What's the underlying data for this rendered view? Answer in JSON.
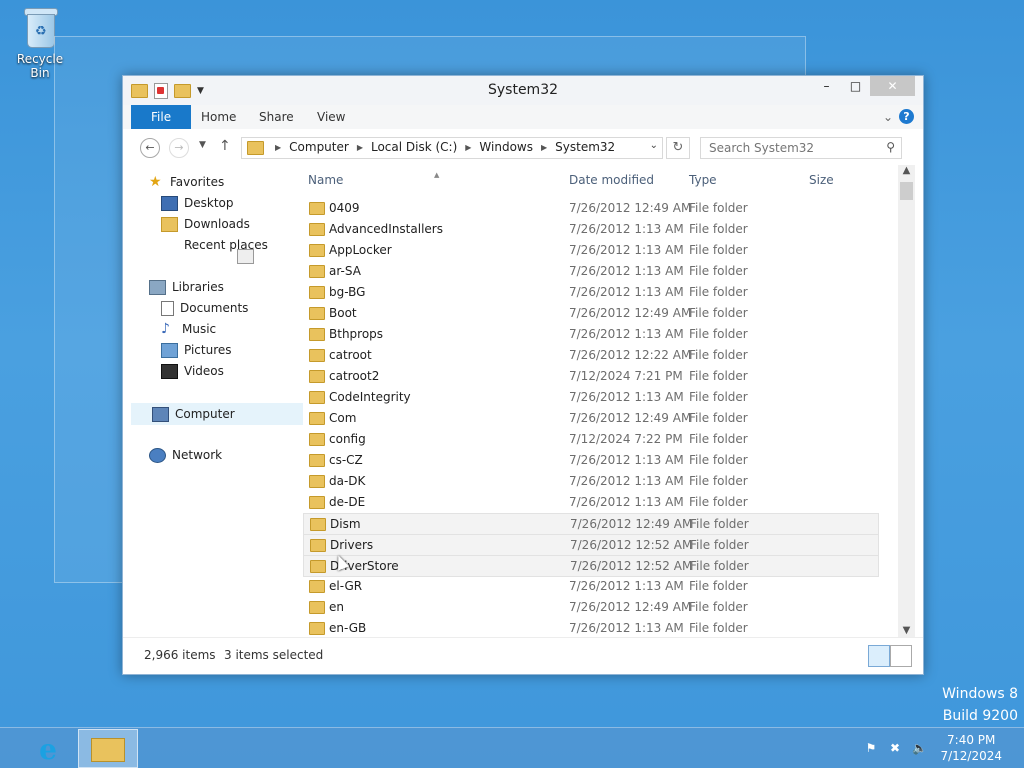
{
  "desktop": {
    "recycle_bin_label": "Recycle Bin",
    "watermark_line1": "Windows 8",
    "watermark_line2": "Build 9200"
  },
  "window": {
    "title": "System32",
    "minimize_glyph": "–",
    "maximize_glyph": "□",
    "close_glyph": "✕"
  },
  "ribbon": {
    "tabs": [
      "File",
      "Home",
      "Share",
      "View"
    ],
    "help_glyph": "?"
  },
  "address": {
    "crumbs": [
      "Computer",
      "Local Disk (C:)",
      "Windows",
      "System32"
    ]
  },
  "search": {
    "placeholder": "Search System32"
  },
  "nav_pane": {
    "favorites": "Favorites",
    "desktop": "Desktop",
    "downloads": "Downloads",
    "recent_places": "Recent places",
    "libraries": "Libraries",
    "documents": "Documents",
    "music": "Music",
    "pictures": "Pictures",
    "videos": "Videos",
    "computer": "Computer",
    "network": "Network"
  },
  "columns": {
    "name": "Name",
    "date_modified": "Date modified",
    "type": "Type",
    "size": "Size"
  },
  "files": [
    {
      "name": "0409",
      "date": "7/26/2012 12:49 AM",
      "type": "File folder",
      "selected": false
    },
    {
      "name": "AdvancedInstallers",
      "date": "7/26/2012 1:13 AM",
      "type": "File folder",
      "selected": false
    },
    {
      "name": "AppLocker",
      "date": "7/26/2012 1:13 AM",
      "type": "File folder",
      "selected": false
    },
    {
      "name": "ar-SA",
      "date": "7/26/2012 1:13 AM",
      "type": "File folder",
      "selected": false
    },
    {
      "name": "bg-BG",
      "date": "7/26/2012 1:13 AM",
      "type": "File folder",
      "selected": false
    },
    {
      "name": "Boot",
      "date": "7/26/2012 12:49 AM",
      "type": "File folder",
      "selected": false
    },
    {
      "name": "Bthprops",
      "date": "7/26/2012 1:13 AM",
      "type": "File folder",
      "selected": false
    },
    {
      "name": "catroot",
      "date": "7/26/2012 12:22 AM",
      "type": "File folder",
      "selected": false
    },
    {
      "name": "catroot2",
      "date": "7/12/2024 7:21 PM",
      "type": "File folder",
      "selected": false
    },
    {
      "name": "CodeIntegrity",
      "date": "7/26/2012 1:13 AM",
      "type": "File folder",
      "selected": false
    },
    {
      "name": "Com",
      "date": "7/26/2012 12:49 AM",
      "type": "File folder",
      "selected": false
    },
    {
      "name": "config",
      "date": "7/12/2024 7:22 PM",
      "type": "File folder",
      "selected": false
    },
    {
      "name": "cs-CZ",
      "date": "7/26/2012 1:13 AM",
      "type": "File folder",
      "selected": false
    },
    {
      "name": "da-DK",
      "date": "7/26/2012 1:13 AM",
      "type": "File folder",
      "selected": false
    },
    {
      "name": "de-DE",
      "date": "7/26/2012 1:13 AM",
      "type": "File folder",
      "selected": false
    },
    {
      "name": "Dism",
      "date": "7/26/2012 12:49 AM",
      "type": "File folder",
      "selected": true
    },
    {
      "name": "Drivers",
      "date": "7/26/2012 12:52 AM",
      "type": "File folder",
      "selected": true
    },
    {
      "name": "DriverStore",
      "date": "7/26/2012 12:52 AM",
      "type": "File folder",
      "selected": true
    },
    {
      "name": "el-GR",
      "date": "7/26/2012 1:13 AM",
      "type": "File folder",
      "selected": false
    },
    {
      "name": "en",
      "date": "7/26/2012 12:49 AM",
      "type": "File folder",
      "selected": false
    },
    {
      "name": "en-GB",
      "date": "7/26/2012 1:13 AM",
      "type": "File folder",
      "selected": false
    }
  ],
  "status": {
    "item_count": "2,966 items",
    "selection": "3 items selected"
  },
  "taskbar": {
    "ie_glyph": "e",
    "clock_time": "7:40 PM",
    "clock_date": "7/12/2024"
  }
}
